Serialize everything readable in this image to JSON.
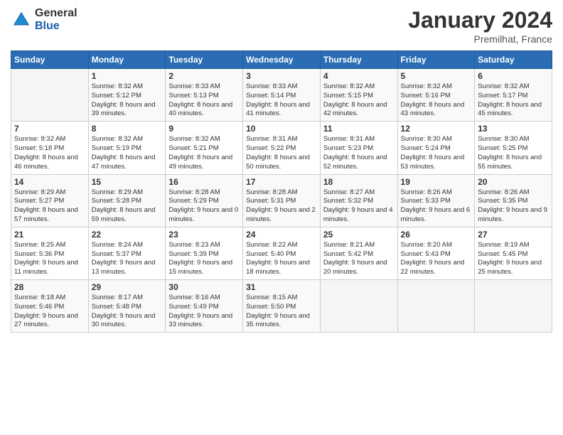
{
  "header": {
    "logo_general": "General",
    "logo_blue": "Blue",
    "title": "January 2024",
    "location": "Premilhat, France"
  },
  "days_of_week": [
    "Sunday",
    "Monday",
    "Tuesday",
    "Wednesday",
    "Thursday",
    "Friday",
    "Saturday"
  ],
  "weeks": [
    [
      {
        "day": "",
        "sunrise": "",
        "sunset": "",
        "daylight": ""
      },
      {
        "day": "1",
        "sunrise": "Sunrise: 8:32 AM",
        "sunset": "Sunset: 5:12 PM",
        "daylight": "Daylight: 8 hours and 39 minutes."
      },
      {
        "day": "2",
        "sunrise": "Sunrise: 8:33 AM",
        "sunset": "Sunset: 5:13 PM",
        "daylight": "Daylight: 8 hours and 40 minutes."
      },
      {
        "day": "3",
        "sunrise": "Sunrise: 8:33 AM",
        "sunset": "Sunset: 5:14 PM",
        "daylight": "Daylight: 8 hours and 41 minutes."
      },
      {
        "day": "4",
        "sunrise": "Sunrise: 8:32 AM",
        "sunset": "Sunset: 5:15 PM",
        "daylight": "Daylight: 8 hours and 42 minutes."
      },
      {
        "day": "5",
        "sunrise": "Sunrise: 8:32 AM",
        "sunset": "Sunset: 5:16 PM",
        "daylight": "Daylight: 8 hours and 43 minutes."
      },
      {
        "day": "6",
        "sunrise": "Sunrise: 8:32 AM",
        "sunset": "Sunset: 5:17 PM",
        "daylight": "Daylight: 8 hours and 45 minutes."
      }
    ],
    [
      {
        "day": "7",
        "sunrise": "Sunrise: 8:32 AM",
        "sunset": "Sunset: 5:18 PM",
        "daylight": "Daylight: 8 hours and 46 minutes."
      },
      {
        "day": "8",
        "sunrise": "Sunrise: 8:32 AM",
        "sunset": "Sunset: 5:19 PM",
        "daylight": "Daylight: 8 hours and 47 minutes."
      },
      {
        "day": "9",
        "sunrise": "Sunrise: 8:32 AM",
        "sunset": "Sunset: 5:21 PM",
        "daylight": "Daylight: 8 hours and 49 minutes."
      },
      {
        "day": "10",
        "sunrise": "Sunrise: 8:31 AM",
        "sunset": "Sunset: 5:22 PM",
        "daylight": "Daylight: 8 hours and 50 minutes."
      },
      {
        "day": "11",
        "sunrise": "Sunrise: 8:31 AM",
        "sunset": "Sunset: 5:23 PM",
        "daylight": "Daylight: 8 hours and 52 minutes."
      },
      {
        "day": "12",
        "sunrise": "Sunrise: 8:30 AM",
        "sunset": "Sunset: 5:24 PM",
        "daylight": "Daylight: 8 hours and 53 minutes."
      },
      {
        "day": "13",
        "sunrise": "Sunrise: 8:30 AM",
        "sunset": "Sunset: 5:25 PM",
        "daylight": "Daylight: 8 hours and 55 minutes."
      }
    ],
    [
      {
        "day": "14",
        "sunrise": "Sunrise: 8:29 AM",
        "sunset": "Sunset: 5:27 PM",
        "daylight": "Daylight: 8 hours and 57 minutes."
      },
      {
        "day": "15",
        "sunrise": "Sunrise: 8:29 AM",
        "sunset": "Sunset: 5:28 PM",
        "daylight": "Daylight: 8 hours and 59 minutes."
      },
      {
        "day": "16",
        "sunrise": "Sunrise: 8:28 AM",
        "sunset": "Sunset: 5:29 PM",
        "daylight": "Daylight: 9 hours and 0 minutes."
      },
      {
        "day": "17",
        "sunrise": "Sunrise: 8:28 AM",
        "sunset": "Sunset: 5:31 PM",
        "daylight": "Daylight: 9 hours and 2 minutes."
      },
      {
        "day": "18",
        "sunrise": "Sunrise: 8:27 AM",
        "sunset": "Sunset: 5:32 PM",
        "daylight": "Daylight: 9 hours and 4 minutes."
      },
      {
        "day": "19",
        "sunrise": "Sunrise: 8:26 AM",
        "sunset": "Sunset: 5:33 PM",
        "daylight": "Daylight: 9 hours and 6 minutes."
      },
      {
        "day": "20",
        "sunrise": "Sunrise: 8:26 AM",
        "sunset": "Sunset: 5:35 PM",
        "daylight": "Daylight: 9 hours and 9 minutes."
      }
    ],
    [
      {
        "day": "21",
        "sunrise": "Sunrise: 8:25 AM",
        "sunset": "Sunset: 5:36 PM",
        "daylight": "Daylight: 9 hours and 11 minutes."
      },
      {
        "day": "22",
        "sunrise": "Sunrise: 8:24 AM",
        "sunset": "Sunset: 5:37 PM",
        "daylight": "Daylight: 9 hours and 13 minutes."
      },
      {
        "day": "23",
        "sunrise": "Sunrise: 8:23 AM",
        "sunset": "Sunset: 5:39 PM",
        "daylight": "Daylight: 9 hours and 15 minutes."
      },
      {
        "day": "24",
        "sunrise": "Sunrise: 8:22 AM",
        "sunset": "Sunset: 5:40 PM",
        "daylight": "Daylight: 9 hours and 18 minutes."
      },
      {
        "day": "25",
        "sunrise": "Sunrise: 8:21 AM",
        "sunset": "Sunset: 5:42 PM",
        "daylight": "Daylight: 9 hours and 20 minutes."
      },
      {
        "day": "26",
        "sunrise": "Sunrise: 8:20 AM",
        "sunset": "Sunset: 5:43 PM",
        "daylight": "Daylight: 9 hours and 22 minutes."
      },
      {
        "day": "27",
        "sunrise": "Sunrise: 8:19 AM",
        "sunset": "Sunset: 5:45 PM",
        "daylight": "Daylight: 9 hours and 25 minutes."
      }
    ],
    [
      {
        "day": "28",
        "sunrise": "Sunrise: 8:18 AM",
        "sunset": "Sunset: 5:46 PM",
        "daylight": "Daylight: 9 hours and 27 minutes."
      },
      {
        "day": "29",
        "sunrise": "Sunrise: 8:17 AM",
        "sunset": "Sunset: 5:48 PM",
        "daylight": "Daylight: 9 hours and 30 minutes."
      },
      {
        "day": "30",
        "sunrise": "Sunrise: 8:16 AM",
        "sunset": "Sunset: 5:49 PM",
        "daylight": "Daylight: 9 hours and 33 minutes."
      },
      {
        "day": "31",
        "sunrise": "Sunrise: 8:15 AM",
        "sunset": "Sunset: 5:50 PM",
        "daylight": "Daylight: 9 hours and 35 minutes."
      },
      {
        "day": "",
        "sunrise": "",
        "sunset": "",
        "daylight": ""
      },
      {
        "day": "",
        "sunrise": "",
        "sunset": "",
        "daylight": ""
      },
      {
        "day": "",
        "sunrise": "",
        "sunset": "",
        "daylight": ""
      }
    ]
  ]
}
